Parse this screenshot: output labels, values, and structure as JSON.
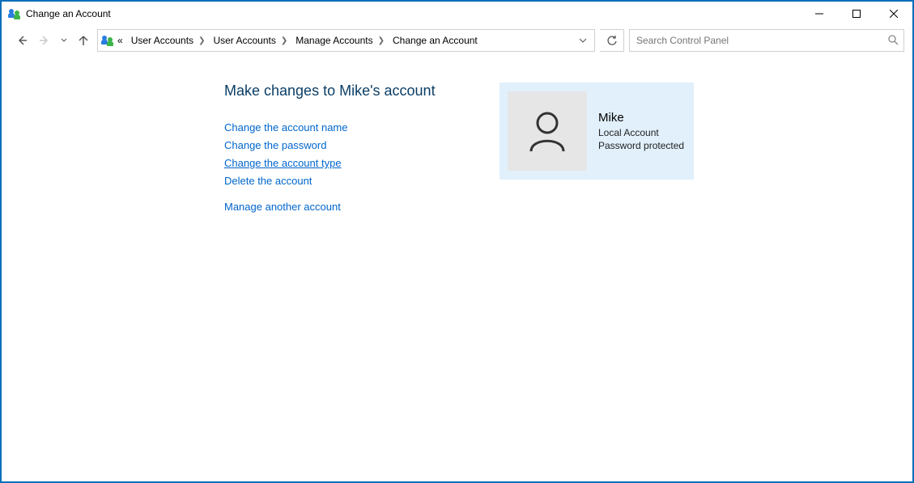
{
  "window": {
    "title": "Change an Account"
  },
  "breadcrumb": {
    "prefix": "«",
    "items": [
      "User Accounts",
      "User Accounts",
      "Manage Accounts",
      "Change an Account"
    ]
  },
  "search": {
    "placeholder": "Search Control Panel"
  },
  "page": {
    "heading": "Make changes to Mike's account",
    "links": {
      "change_name": "Change the account name",
      "change_password": "Change the password",
      "change_type": "Change the account type",
      "delete": "Delete the account",
      "manage_another": "Manage another account"
    }
  },
  "account": {
    "name": "Mike",
    "type": "Local Account",
    "status": "Password protected"
  }
}
